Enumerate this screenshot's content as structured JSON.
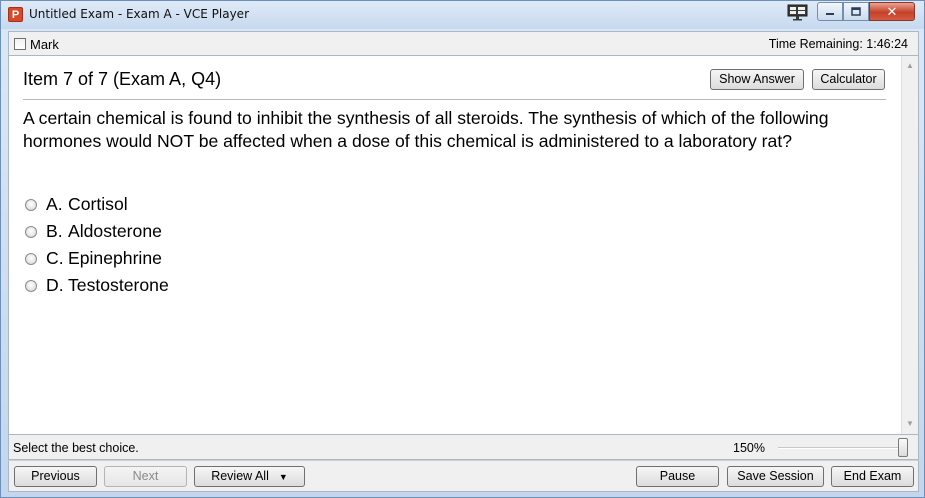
{
  "window": {
    "title": "Untitled Exam - Exam A - VCE Player",
    "app_icon_letter": "P",
    "close_glyph": "✕"
  },
  "topbar": {
    "mark_label": "Mark",
    "time_remaining": "Time Remaining: 1:46:24"
  },
  "question": {
    "item_label": "Item 7 of 7  (Exam A, Q4)",
    "show_answer_label": "Show Answer",
    "calculator_label": "Calculator",
    "text": "A certain chemical is found to inhibit the synthesis of all steroids. The synthesis of which of the following hormones would NOT be affected when a dose of this chemical is administered to a laboratory rat?",
    "choices": [
      {
        "letter": "A.",
        "text": "Cortisol"
      },
      {
        "letter": "B.",
        "text": "Aldosterone"
      },
      {
        "letter": "C.",
        "text": "Epinephrine"
      },
      {
        "letter": "D.",
        "text": "Testosterone"
      }
    ]
  },
  "statusbar": {
    "instruction": "Select the best choice.",
    "zoom_label": "150%",
    "zoom_level_fraction": 1.0
  },
  "bottombar": {
    "previous_label": "Previous",
    "next_label": "Next",
    "review_all_label": "Review All",
    "pause_label": "Pause",
    "save_session_label": "Save Session",
    "end_exam_label": "End Exam"
  },
  "icons": {
    "app": "app-logo-icon",
    "layout": "monitor-layout-icon",
    "minimize": "minimize-icon",
    "maximize": "maximize-icon",
    "close": "close-icon",
    "dropdown": "chevron-down-icon"
  },
  "colors": {
    "titlebar": "#c6d9ef",
    "close_button": "#c5412a",
    "app_icon": "#d8492c"
  }
}
